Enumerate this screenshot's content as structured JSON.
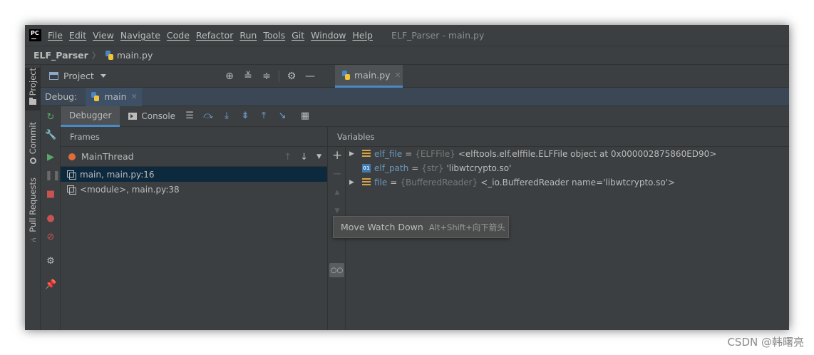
{
  "window": {
    "logo": "PC",
    "title": "ELF_Parser - main.py"
  },
  "menu": [
    "File",
    "Edit",
    "View",
    "Navigate",
    "Code",
    "Refactor",
    "Run",
    "Tools",
    "Git",
    "Window",
    "Help"
  ],
  "breadcrumb": {
    "project": "ELF_Parser",
    "file": "main.py"
  },
  "side_tabs": {
    "project": "Project",
    "commit": "Commit",
    "pull_requests": "Pull Requests"
  },
  "project_toolbar": {
    "label": "Project",
    "file_tab": "main.py"
  },
  "debug": {
    "label": "Debug:",
    "session": "main"
  },
  "debugger_tabs": {
    "debugger": "Debugger",
    "console": "Console"
  },
  "frames": {
    "title": "Frames",
    "thread": "MainThread",
    "items": [
      {
        "label": "main, main.py:16"
      },
      {
        "label": "<module>, main.py:38"
      }
    ]
  },
  "variables": {
    "title": "Variables",
    "items": [
      {
        "name": "elf_file",
        "eq": "=",
        "type": "{ELFFile}",
        "value": "<elftools.elf.elffile.ELFFile object at 0x000002875860ED90>"
      },
      {
        "name": "elf_path",
        "eq": "=",
        "type": "{str}",
        "value": "'libwtcrypto.so'"
      },
      {
        "name": "file",
        "eq": "=",
        "type": "{BufferedReader}",
        "value": "<_io.BufferedReader name='libwtcrypto.so'>"
      }
    ]
  },
  "tooltip": {
    "text": "Move Watch Down",
    "shortcut": "Alt+Shift+向下箭头"
  },
  "watermark": "CSDN @韩曙亮"
}
